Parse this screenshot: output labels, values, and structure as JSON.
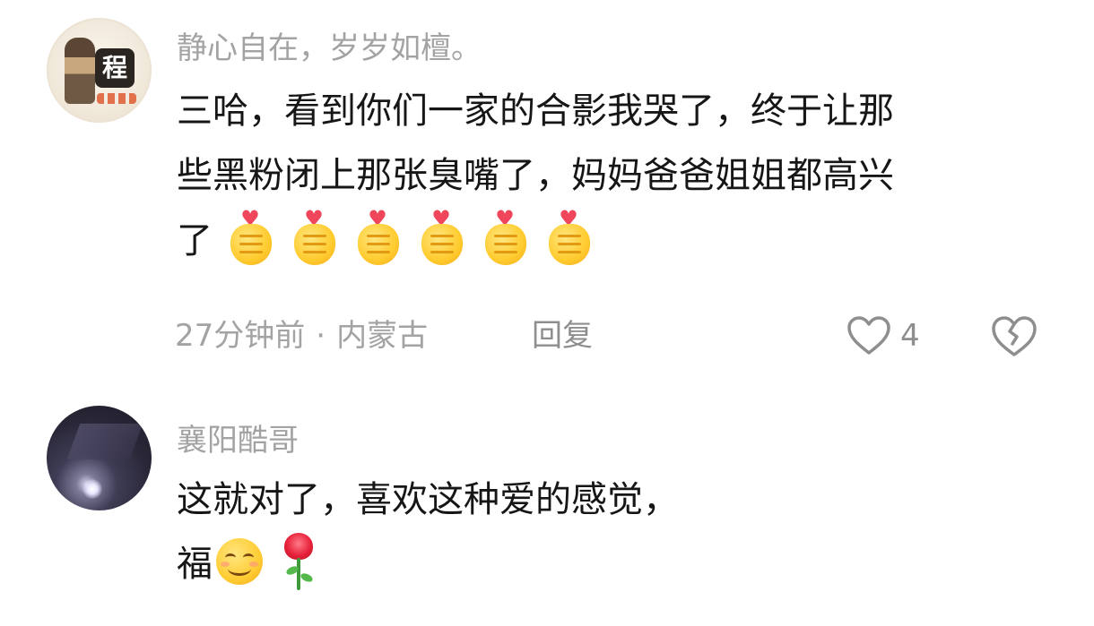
{
  "comments": [
    {
      "username": "静心自在，岁岁如檀。",
      "avatar": {
        "badge_char": "程"
      },
      "lines": [
        "三哈，看到你们一家的合影我哭了，终于让那",
        "些黑粉闭上那张臭嘴了，妈妈爸爸姐姐都高兴",
        "了"
      ],
      "emoji_trailing": [
        "heart-hands-icon",
        "heart-hands-icon",
        "heart-hands-icon",
        "heart-hands-icon",
        "heart-hands-icon",
        "heart-hands-icon"
      ],
      "time": "27分钟前",
      "separator": "·",
      "location": "内蒙古",
      "reply_label": "回复",
      "like_count": "4"
    },
    {
      "username": "襄阳酷哥",
      "lines": [
        "这就对了，喜欢这种爱的感觉，",
        "福"
      ],
      "emoji_trailing": [
        "smiling-face-icon",
        "rose-icon"
      ]
    }
  ],
  "colors": {
    "text": "#161616",
    "secondary_text": "#a3a3a3",
    "icon_gray": "#8e8e8e",
    "emoji_yellow": "#ffcb2e",
    "heart_red": "#f0465c"
  }
}
